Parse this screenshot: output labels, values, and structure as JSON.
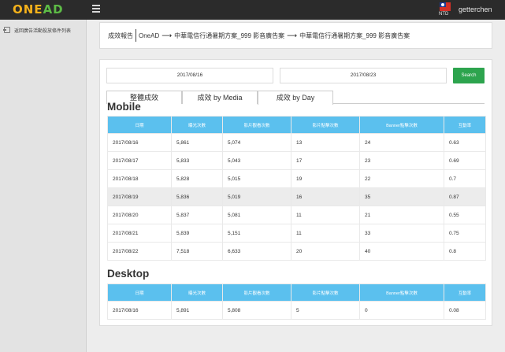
{
  "header": {
    "logo": {
      "part1": "ONE",
      "part2": "AD"
    },
    "currency": "NTD",
    "username": "getterchen"
  },
  "sidebar": {
    "items": [
      {
        "label": "返回廣告活動投放條件列表"
      }
    ]
  },
  "breadcrumb": {
    "title": "成效報告",
    "items": [
      "OneAD",
      "中華電信行通暑期方案_999 影音廣告案",
      "中華電信行通暑期方案_999 影音廣告案"
    ]
  },
  "filters": {
    "start_date": "2017/08/16",
    "end_date": "2017/08/23",
    "search_label": "Search"
  },
  "tabs": [
    {
      "label": "整體成效"
    },
    {
      "label": "成效 by Media"
    },
    {
      "label": "成效 by Day"
    }
  ],
  "active_tab": 2,
  "mobile": {
    "title": "Mobile",
    "columns": [
      "日期",
      "曝光次數",
      "影片觀看次數",
      "影片點擊次數",
      "Banner點擊次數",
      "互動率"
    ],
    "rows": [
      [
        "2017/08/16",
        "5,861",
        "5,074",
        "13",
        "24",
        "0.63"
      ],
      [
        "2017/08/17",
        "5,833",
        "5,043",
        "17",
        "23",
        "0.69"
      ],
      [
        "2017/08/18",
        "5,828",
        "5,015",
        "19",
        "22",
        "0.7"
      ],
      [
        "2017/08/19",
        "5,836",
        "5,019",
        "16",
        "35",
        "0.87"
      ],
      [
        "2017/08/20",
        "5,837",
        "5,081",
        "11",
        "21",
        "0.55"
      ],
      [
        "2017/08/21",
        "5,839",
        "5,151",
        "11",
        "33",
        "0.75"
      ],
      [
        "2017/08/22",
        "7,518",
        "6,633",
        "20",
        "40",
        "0.8"
      ]
    ]
  },
  "desktop": {
    "title": "Desktop",
    "columns": [
      "日期",
      "曝光次數",
      "影片觀看次數",
      "影片點擊次數",
      "Banner點擊次數",
      "互動率"
    ],
    "rows": [
      [
        "2017/08/16",
        "5,891",
        "5,808",
        "5",
        "0",
        "0.08"
      ]
    ]
  },
  "colors": {
    "topbar": "#2b2b2b",
    "logo_orange": "#f5b21b",
    "logo_green": "#5dbb46",
    "table_header": "#5bc0ee",
    "search_button": "#2da44e",
    "highlight_row": "#ececec"
  },
  "icons": {
    "menu": "hamburger-menu-icon",
    "flag": "taiwan-flag-icon",
    "back": "back-arrow-icon"
  }
}
